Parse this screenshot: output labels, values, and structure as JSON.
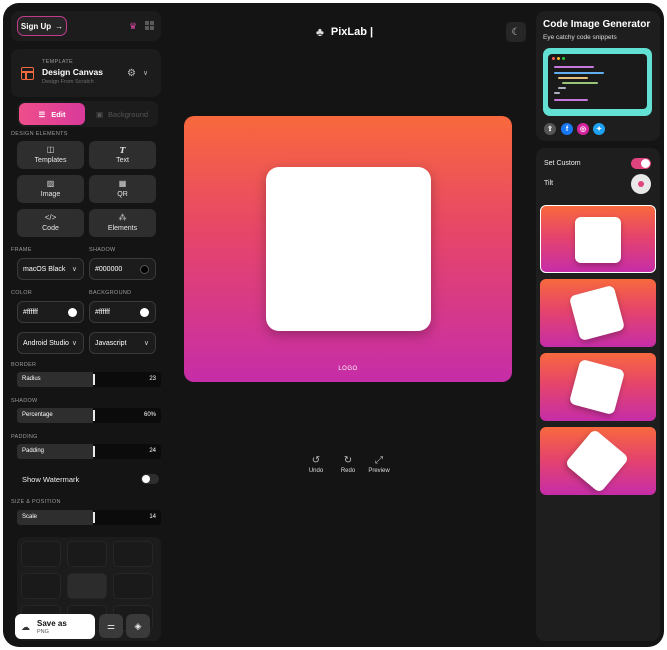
{
  "topbar": {
    "signup_label": "Sign Up",
    "signup_arrow": "→"
  },
  "template": {
    "section_label": "TEMPLATE",
    "name": "Design Canvas",
    "subtitle": "Design From Scratch"
  },
  "modes": {
    "edit_label": "Edit",
    "background_label": "Background"
  },
  "design_elements": {
    "section_label": "DESIGN ELEMENTS",
    "items": [
      {
        "label": "Templates",
        "icon": "template-icon"
      },
      {
        "label": "Text",
        "icon": "text-icon"
      },
      {
        "label": "Image",
        "icon": "image-icon"
      },
      {
        "label": "QR",
        "icon": "qr-icon"
      },
      {
        "label": "Code",
        "icon": "code-icon"
      },
      {
        "label": "Elements",
        "icon": "elements-icon"
      }
    ]
  },
  "frame": {
    "label": "FRAME",
    "value": "macOS Black"
  },
  "shadow_color": {
    "label": "SHADOW",
    "value": "#000000",
    "swatch": "#000000"
  },
  "color": {
    "label": "COLOR",
    "value": "#ffffff",
    "swatch": "#ffffff"
  },
  "background": {
    "label": "BACKGROUND",
    "value": "#ffffff",
    "swatch": "#ffffff"
  },
  "theme_select": {
    "value": "Android Studio"
  },
  "language_select": {
    "value": "Javascript"
  },
  "border": {
    "section_label": "BORDER",
    "slider_label": "Radius",
    "value": "23"
  },
  "shadow": {
    "section_label": "SHADOW",
    "slider_label": "Percentage",
    "value": "60%"
  },
  "padding": {
    "section_label": "PADDING",
    "slider_label": "Padding",
    "value": "24"
  },
  "watermark": {
    "label": "Show Watermark"
  },
  "size_position": {
    "section_label": "SIZE & POSITION",
    "slider_label": "Scale",
    "value": "14"
  },
  "save": {
    "title": "Save as",
    "format": "PNG"
  },
  "brand": {
    "name": "PixLab |"
  },
  "canvas": {
    "logo_text": "LOGO",
    "gradient_top": "#f8693d",
    "gradient_bottom": "#c62da8"
  },
  "actions": {
    "undo": "Undo",
    "redo": "Redo",
    "preview": "Preview"
  },
  "promo": {
    "title": "Code Image Generator",
    "subtitle": "Eye catchy code snippets"
  },
  "options": {
    "set_custom": "Set Custom",
    "tilt": "Tilt"
  },
  "colors": {
    "accent": "#e0447e",
    "panel": "#1c1c1c",
    "frame": "#141414",
    "promo_teal": "#62e0d3"
  }
}
